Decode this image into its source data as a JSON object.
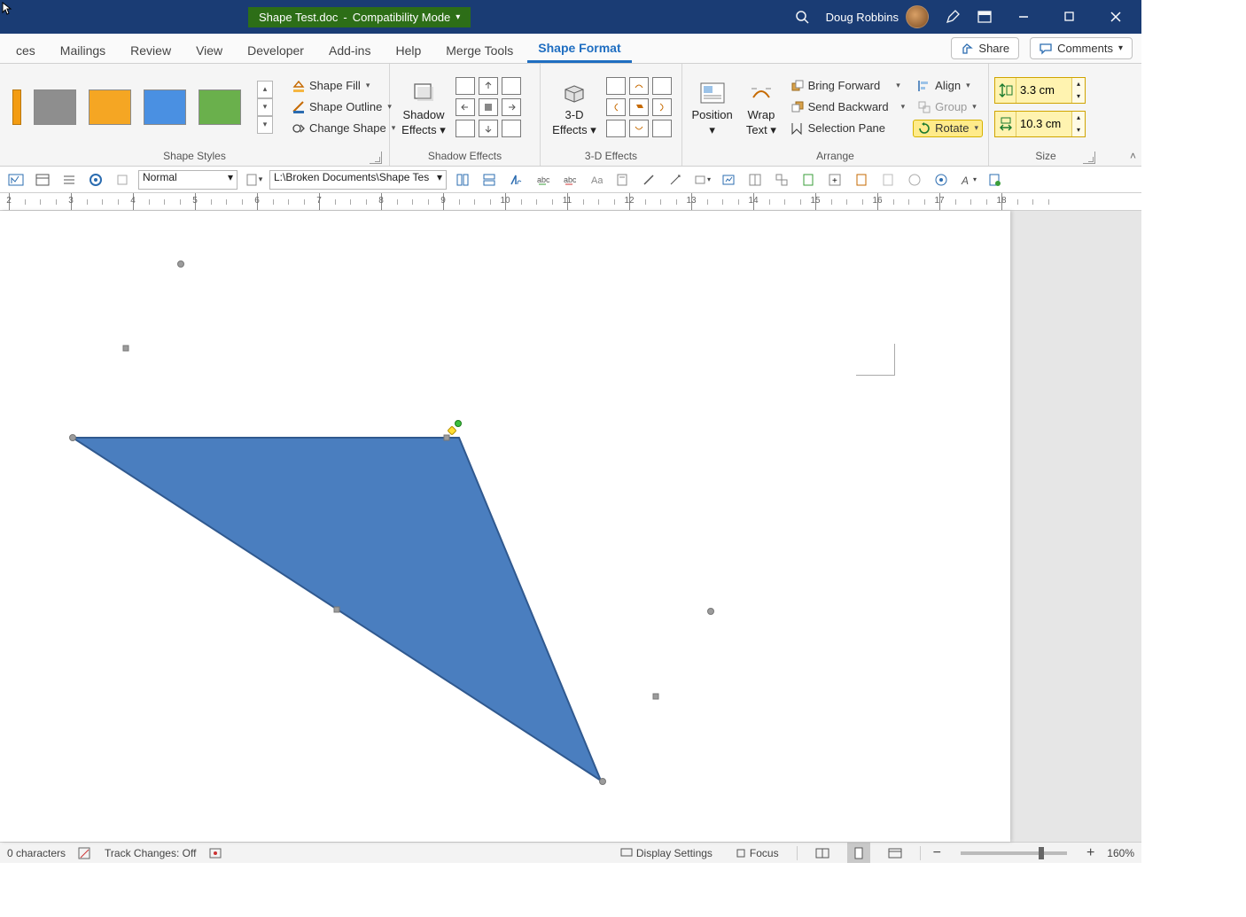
{
  "titlebar": {
    "document_name": "Shape Test.doc",
    "mode": "Compatibility Mode",
    "user_name": "Doug Robbins"
  },
  "tabs": {
    "items": [
      "ces",
      "Mailings",
      "Review",
      "View",
      "Developer",
      "Add-ins",
      "Help",
      "Merge Tools",
      "Shape Format"
    ],
    "active_index": 8,
    "share": "Share",
    "comments": "Comments"
  },
  "ribbon": {
    "shape_styles_label": "Shape Styles",
    "shape_fill": "Shape Fill",
    "shape_outline": "Shape Outline",
    "change_shape": "Change Shape",
    "shadow_effects_btn": "Shadow",
    "shadow_effects_btn2": "Effects",
    "shadow_effects_label": "Shadow Effects",
    "threeD_btn": "3-D",
    "threeD_btn2": "Effects",
    "threeD_label": "3-D Effects",
    "position": "Position",
    "wrap_text": "Wrap",
    "wrap_text2": "Text",
    "bring_forward": "Bring Forward",
    "send_backward": "Send Backward",
    "selection_pane": "Selection Pane",
    "align": "Align",
    "group": "Group",
    "rotate": "Rotate",
    "arrange_label": "Arrange",
    "size_label": "Size",
    "height": "3.3 cm",
    "width": "10.3 cm"
  },
  "qat": {
    "style": "Normal",
    "path": "L:\\Broken Documents\\Shape Tes"
  },
  "ruler": {
    "start": 2,
    "end": 18
  },
  "status": {
    "chars": "0 characters",
    "track": "Track Changes: Off",
    "display_settings": "Display Settings",
    "focus": "Focus",
    "zoom": "160%"
  },
  "shape": {
    "fill": "#4a7ebf",
    "stroke": "#30598f"
  }
}
